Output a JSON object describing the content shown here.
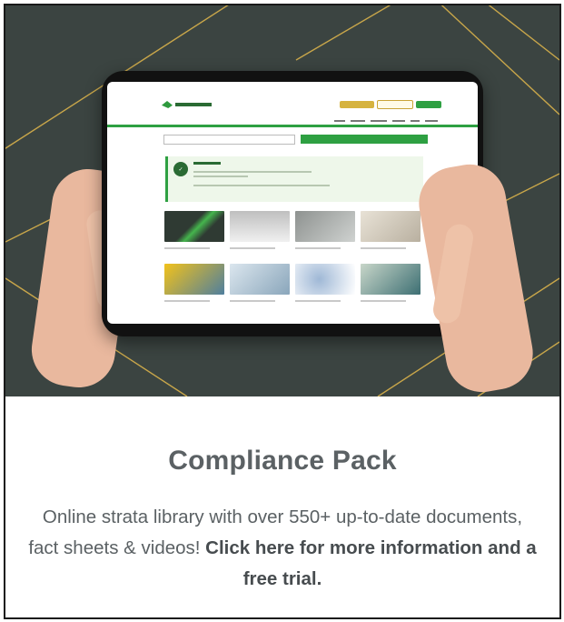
{
  "promo": {
    "title": "Compliance Pack",
    "description": "Online strata library with over 550+ up-to-date documents, fact sheets & videos!",
    "cta": "Click here for more information and a free trial."
  },
  "colors": {
    "background_dark": "#3b4441",
    "gold_line": "#c8a64a",
    "brand_green": "#2ea042",
    "text_gray": "#5b6164"
  },
  "icons": {
    "logo": "bannermans-logo-icon",
    "compliance": "compliance-pack-icon"
  }
}
